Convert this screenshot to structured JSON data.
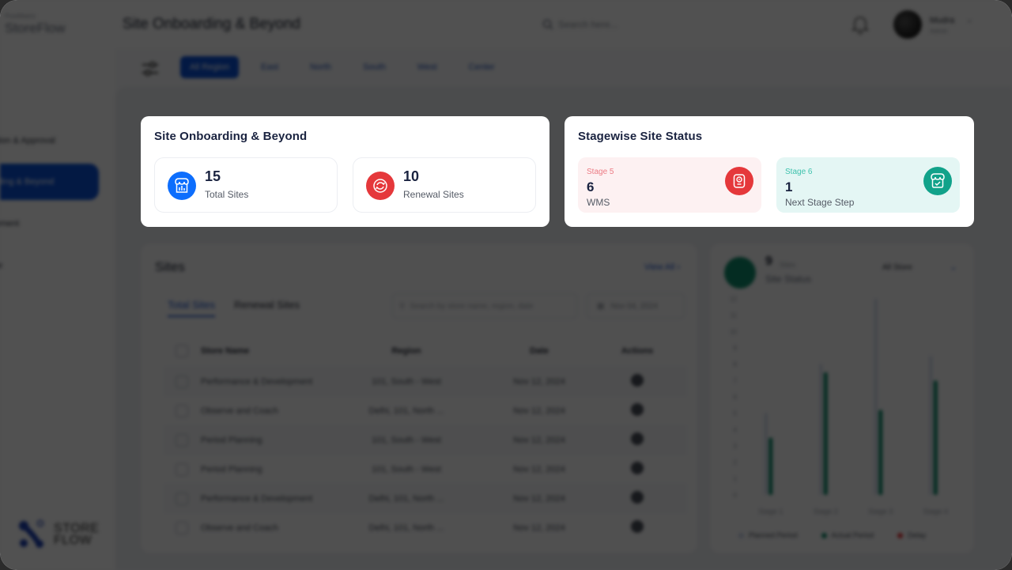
{
  "app": {
    "brand_small": "PixelMatrix",
    "brand": "StoreFlow",
    "logo_text_line1": "STORE",
    "logo_text_line2": "FLOW"
  },
  "sidebar": {
    "items": [
      {
        "label": "Location & Approval",
        "active": false
      },
      {
        "label": "Onboarding & Beyond",
        "active": true
      },
      {
        "label": "Management",
        "active": false
      },
      {
        "label": "Finance",
        "active": false
      }
    ]
  },
  "header": {
    "title": "Site Onboarding & Beyond",
    "search_placeholder": "Search here...",
    "user_name": "Mudra",
    "user_role": "Admin"
  },
  "regions": {
    "tabs": [
      "All Region",
      "East",
      "North",
      "South",
      "West",
      "Center"
    ],
    "active": "All Region"
  },
  "onboarding_card": {
    "title": "Site Onboarding & Beyond",
    "stats": [
      {
        "value": "15",
        "label": "Total Sites",
        "icon": "store-icon",
        "color": "#0d6efd"
      },
      {
        "value": "10",
        "label": "Renewal Sites",
        "icon": "renew-icon",
        "color": "#e5383b"
      }
    ]
  },
  "stage_card": {
    "title": "Stagewise Site Status",
    "stages": [
      {
        "stage": "Stage 5",
        "value": "6",
        "label": "WMS",
        "icon": "device-icon",
        "color": "#e5383b",
        "bg": "#fdf1f2",
        "stage_color": "#ec7b84"
      },
      {
        "stage": "Stage 6",
        "value": "1",
        "label": "Next Stage Step",
        "icon": "store-check-icon",
        "color": "#11a28a",
        "bg": "#e4f6f4",
        "stage_color": "#3ec2ad"
      }
    ]
  },
  "sites": {
    "title": "Sites",
    "view_all": "View All",
    "tabs": [
      "Total Sites",
      "Renewal Sites"
    ],
    "active_tab": "Total Sites",
    "search_placeholder": "Search by store name, region, date",
    "date_filter": "Nov 04, 2024",
    "columns": [
      "Store Name",
      "Region",
      "Date",
      "Actions"
    ],
    "rows": [
      {
        "name": "Performance & Development",
        "region": "101, South - West",
        "date": "Nov 12, 2024"
      },
      {
        "name": "Observe and Coach",
        "region": "Delhi, 101, North ...",
        "date": "Nov 12, 2024"
      },
      {
        "name": "Period Planning",
        "region": "101, South - West",
        "date": "Nov 12, 2024"
      },
      {
        "name": "Period Planning",
        "region": "101, South - West",
        "date": "Nov 12, 2024"
      },
      {
        "name": "Performance & Development",
        "region": "Delhi, 101, North ...",
        "date": "Nov 12, 2024"
      },
      {
        "name": "Observe and Coach",
        "region": "Delhi, 101, North ...",
        "date": "Nov 12, 2024"
      }
    ]
  },
  "site_status": {
    "count": "9",
    "unit": "Sites",
    "subtitle": "Site Status",
    "store_select": "All Store"
  },
  "chart_data": {
    "type": "bar",
    "title": "Site Status",
    "categories": [
      "Stage 1",
      "Stage 2",
      "Stage 3",
      "Stage 4"
    ],
    "series": [
      {
        "name": "Planned Period",
        "color": "#c9d3e6",
        "values": [
          5,
          8,
          12,
          8.5
        ]
      },
      {
        "name": "Actual Period",
        "color": "#0f8a6a",
        "values": [
          3.5,
          7.5,
          5.2,
          7
        ]
      },
      {
        "name": "Delay",
        "color": "#e5383b",
        "values": [
          0,
          0,
          0,
          0
        ]
      }
    ],
    "ylim": [
      0,
      12
    ],
    "yticks": [
      0,
      1,
      2,
      3,
      4,
      5,
      6,
      7,
      8,
      9,
      10,
      11,
      12
    ],
    "legend": "bottom"
  }
}
